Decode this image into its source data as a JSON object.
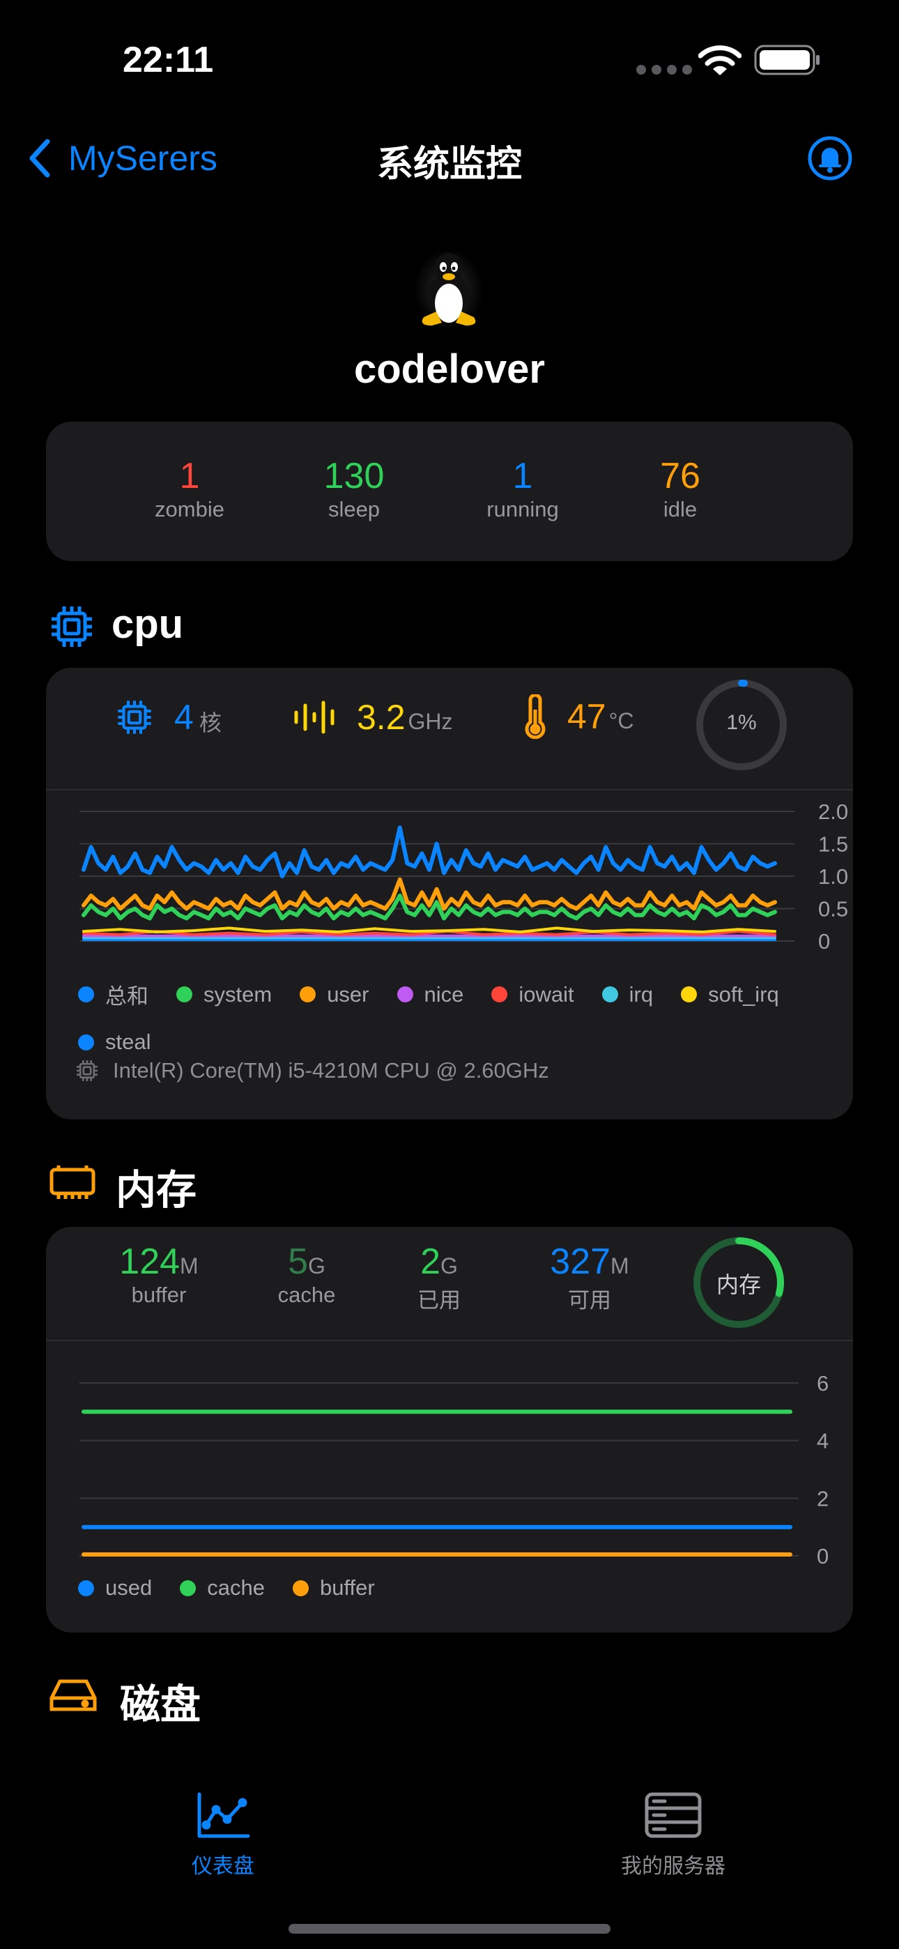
{
  "status_bar": {
    "time": "22:11"
  },
  "nav": {
    "back_label": "MySerers",
    "title": "系统监控"
  },
  "host": {
    "name": "codelover"
  },
  "processes": [
    {
      "value": "1",
      "label": "zombie",
      "color": "#ff453a"
    },
    {
      "value": "130",
      "label": "sleep",
      "color": "#30d158"
    },
    {
      "value": "1",
      "label": "running",
      "color": "#0a84ff"
    },
    {
      "value": "76",
      "label": "idle",
      "color": "#ff9f0a"
    }
  ],
  "cpu": {
    "title": "cpu",
    "cores_value": "4",
    "cores_unit": "核",
    "freq_value": "3.2",
    "freq_unit": "GHz",
    "temp_value": "47",
    "temp_unit": "°C",
    "usage_label": "1%",
    "usage_fraction": 0.01,
    "model": "Intel(R) Core(TM) i5-4210M CPU @ 2.60GHz",
    "legend": [
      {
        "label": "总和",
        "color": "#0a84ff"
      },
      {
        "label": "system",
        "color": "#30d158"
      },
      {
        "label": "user",
        "color": "#ff9f0a"
      },
      {
        "label": "nice",
        "color": "#bf5af2"
      },
      {
        "label": "iowait",
        "color": "#ff453a"
      },
      {
        "label": "irq",
        "color": "#40c8e0"
      },
      {
        "label": "soft_irq",
        "color": "#ffd60a"
      },
      {
        "label": "steal",
        "color": "#0a84ff"
      }
    ]
  },
  "memory": {
    "title": "内存",
    "stats": [
      {
        "value": "124",
        "unit": "M",
        "label": "buffer",
        "color": "#30d158"
      },
      {
        "value": "5",
        "unit": "G",
        "label": "cache",
        "color": "#2f7d4a"
      },
      {
        "value": "2",
        "unit": "G",
        "label": "已用",
        "color": "#30d158"
      },
      {
        "value": "327",
        "unit": "M",
        "label": "可用",
        "color": "#0a84ff"
      }
    ],
    "ring_label": "内存",
    "legend": [
      {
        "label": "used",
        "color": "#0a84ff"
      },
      {
        "label": "cache",
        "color": "#30d158"
      },
      {
        "label": "buffer",
        "color": "#ff9f0a"
      }
    ]
  },
  "disk": {
    "title": "磁盘"
  },
  "tabs": [
    {
      "label": "仪表盘",
      "active": true,
      "color": "#0a84ff"
    },
    {
      "label": "我的服务器",
      "active": false,
      "color": "#8e8e93"
    }
  ],
  "chart_data": [
    {
      "type": "line",
      "title": "",
      "ylim": [
        0,
        2.0
      ],
      "yticks": [
        "2.0",
        "1.5",
        "1.0",
        "0.5",
        "0"
      ],
      "grid": true,
      "legend_position": "bottom",
      "series": [
        {
          "name": "总和",
          "values": [
            1.1,
            1.45,
            1.2,
            1.1,
            1.3,
            1.05,
            1.15,
            1.35,
            1.1,
            1.05,
            1.3,
            1.15,
            1.45,
            1.25,
            1.1,
            1.2,
            1.15,
            1.05,
            1.25,
            1.1,
            1.2,
            1.05,
            1.3,
            1.15,
            1.1,
            1.25,
            1.35,
            1.0,
            1.2,
            1.05,
            1.4,
            1.15,
            1.1,
            1.25,
            1.05,
            1.2,
            1.15,
            1.3,
            1.1,
            1.2,
            1.15,
            1.1,
            1.25,
            1.75,
            1.2,
            1.15,
            1.35,
            1.1,
            1.5,
            1.05,
            1.25,
            1.1,
            1.4,
            1.2,
            1.15,
            1.35,
            1.1,
            1.25,
            1.2,
            1.15,
            1.3,
            1.1,
            1.15,
            1.2,
            1.1,
            1.25,
            1.15,
            1.05,
            1.2,
            1.3,
            1.1,
            1.45,
            1.2,
            1.1,
            1.25,
            1.15,
            1.1,
            1.45,
            1.2,
            1.15,
            1.3,
            1.1,
            1.2,
            1.05,
            1.45,
            1.25,
            1.1,
            1.2,
            1.35,
            1.15,
            1.1,
            1.3,
            1.2,
            1.15,
            1.2
          ]
        },
        {
          "name": "system",
          "values": [
            0.4,
            0.55,
            0.45,
            0.4,
            0.5,
            0.35,
            0.45,
            0.5,
            0.4,
            0.35,
            0.55,
            0.45,
            0.5,
            0.4,
            0.35,
            0.45,
            0.4,
            0.35,
            0.5,
            0.4,
            0.45,
            0.35,
            0.5,
            0.45,
            0.4,
            0.5,
            0.55,
            0.35,
            0.45,
            0.4,
            0.55,
            0.45,
            0.4,
            0.5,
            0.35,
            0.45,
            0.4,
            0.5,
            0.4,
            0.45,
            0.4,
            0.35,
            0.5,
            0.7,
            0.45,
            0.4,
            0.55,
            0.4,
            0.6,
            0.35,
            0.5,
            0.4,
            0.55,
            0.45,
            0.4,
            0.5,
            0.4,
            0.45,
            0.45,
            0.4,
            0.5,
            0.4,
            0.45,
            0.45,
            0.4,
            0.5,
            0.4,
            0.35,
            0.45,
            0.5,
            0.4,
            0.55,
            0.45,
            0.4,
            0.5,
            0.4,
            0.4,
            0.55,
            0.45,
            0.4,
            0.5,
            0.4,
            0.45,
            0.35,
            0.55,
            0.5,
            0.4,
            0.45,
            0.55,
            0.4,
            0.4,
            0.5,
            0.45,
            0.4,
            0.45
          ]
        },
        {
          "name": "user",
          "values": [
            0.55,
            0.7,
            0.6,
            0.55,
            0.65,
            0.5,
            0.6,
            0.7,
            0.55,
            0.5,
            0.7,
            0.6,
            0.75,
            0.6,
            0.5,
            0.6,
            0.55,
            0.5,
            0.65,
            0.55,
            0.6,
            0.5,
            0.7,
            0.6,
            0.55,
            0.65,
            0.75,
            0.5,
            0.6,
            0.55,
            0.75,
            0.6,
            0.55,
            0.65,
            0.5,
            0.6,
            0.55,
            0.7,
            0.55,
            0.6,
            0.55,
            0.5,
            0.65,
            0.95,
            0.6,
            0.55,
            0.75,
            0.55,
            0.8,
            0.5,
            0.65,
            0.55,
            0.75,
            0.6,
            0.55,
            0.7,
            0.55,
            0.6,
            0.6,
            0.55,
            0.7,
            0.55,
            0.6,
            0.6,
            0.55,
            0.65,
            0.55,
            0.5,
            0.6,
            0.7,
            0.55,
            0.75,
            0.6,
            0.55,
            0.65,
            0.55,
            0.55,
            0.75,
            0.6,
            0.55,
            0.7,
            0.55,
            0.6,
            0.5,
            0.75,
            0.65,
            0.55,
            0.6,
            0.7,
            0.55,
            0.55,
            0.7,
            0.6,
            0.55,
            0.6
          ]
        },
        {
          "name": "nice",
          "values": [
            0.08,
            0.08,
            0.08,
            0.08,
            0.08,
            0.08,
            0.08,
            0.08,
            0.08,
            0.08
          ]
        },
        {
          "name": "iowait",
          "values": [
            0.12,
            0.1,
            0.15,
            0.1,
            0.12,
            0.1,
            0.14,
            0.1,
            0.12,
            0.1,
            0.15,
            0.1,
            0.12,
            0.1,
            0.14,
            0.1,
            0.12,
            0.1,
            0.15,
            0.1
          ]
        },
        {
          "name": "irq",
          "values": [
            0.05,
            0.05,
            0.05,
            0.05,
            0.05,
            0.05,
            0.05,
            0.05,
            0.05,
            0.05
          ]
        },
        {
          "name": "soft_irq",
          "values": [
            0.15,
            0.18,
            0.14,
            0.16,
            0.2,
            0.15,
            0.17,
            0.14,
            0.19,
            0.15,
            0.16,
            0.18,
            0.14,
            0.2,
            0.15,
            0.17,
            0.16,
            0.14,
            0.18,
            0.15
          ]
        },
        {
          "name": "steal",
          "values": [
            0.02,
            0.02,
            0.02,
            0.02,
            0.02,
            0.02,
            0.02,
            0.02,
            0.02,
            0.02
          ]
        }
      ]
    },
    {
      "type": "line",
      "title": "",
      "ylim": [
        0,
        6
      ],
      "yticks": [
        "6",
        "4",
        "2",
        "0"
      ],
      "grid": true,
      "legend_position": "bottom",
      "series": [
        {
          "name": "used",
          "values": [
            1.0,
            1.0
          ]
        },
        {
          "name": "cache",
          "values": [
            5.0,
            5.0
          ]
        },
        {
          "name": "buffer",
          "values": [
            0.0,
            0.0
          ]
        }
      ]
    }
  ]
}
